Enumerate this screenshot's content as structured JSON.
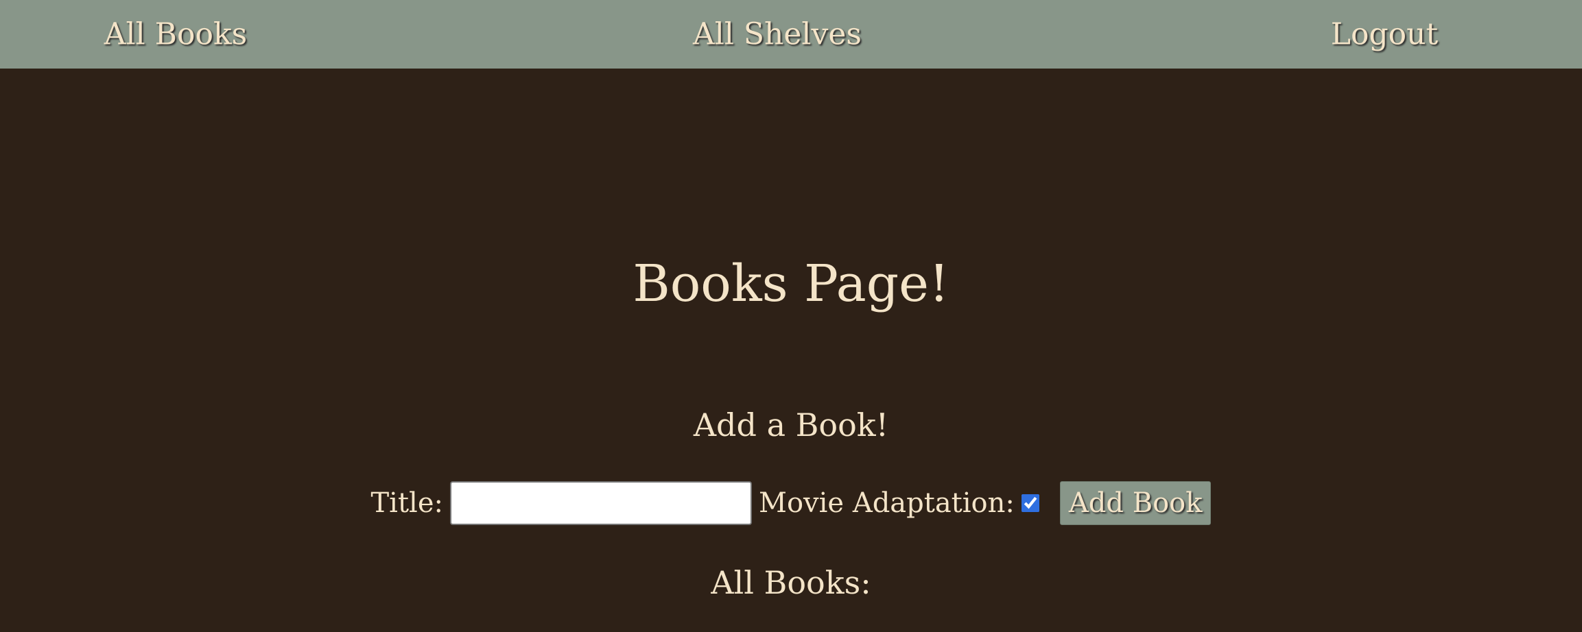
{
  "nav": {
    "all_books": "All Books",
    "all_shelves": "All Shelves",
    "logout": "Logout"
  },
  "page": {
    "title": "Books Page!"
  },
  "add_book": {
    "heading": "Add a Book!",
    "title_label": "Title:",
    "title_value": "",
    "movie_label": "Movie Adaptation:",
    "movie_checked": true,
    "button_label": "Add Book"
  },
  "list": {
    "heading": "All Books:"
  },
  "colors": {
    "navbar": "#889689",
    "background": "#2e2117",
    "text": "#f4e4c8",
    "checkbox_accent": "#2f6fe0"
  }
}
